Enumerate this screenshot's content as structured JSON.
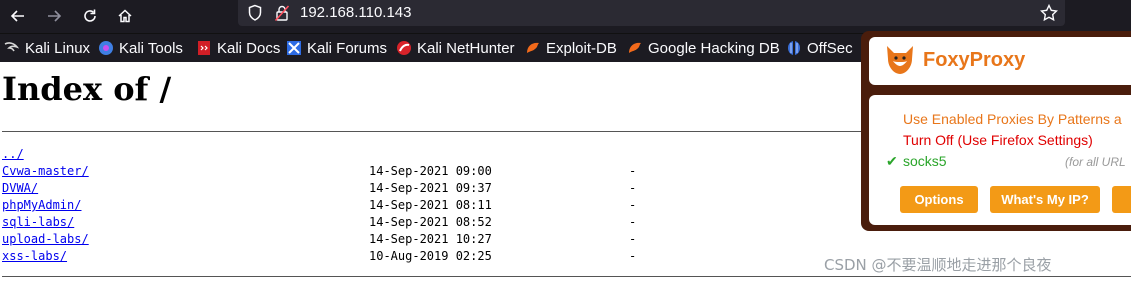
{
  "browser": {
    "url": "192.168.110.143"
  },
  "bookmarks": [
    {
      "label": "Kali Linux",
      "icon": "kali-dragon-icon"
    },
    {
      "label": "Kali Tools",
      "icon": "kali-tools-icon"
    },
    {
      "label": "Kali Docs",
      "icon": "kali-docs-icon"
    },
    {
      "label": "Kali Forums",
      "icon": "kali-forums-icon"
    },
    {
      "label": "Kali NetHunter",
      "icon": "nethunter-icon"
    },
    {
      "label": "Exploit-DB",
      "icon": "exploit-db-icon"
    },
    {
      "label": "Google Hacking DB",
      "icon": "ghdb-icon"
    },
    {
      "label": "OffSec",
      "icon": "offsec-icon"
    }
  ],
  "page": {
    "title": "Index of /",
    "parent_link": "../",
    "entries": [
      {
        "name": "Cvwa-master/",
        "date": "14-Sep-2021 09:00",
        "size": "-"
      },
      {
        "name": "DVWA/",
        "date": "14-Sep-2021 09:37",
        "size": "-"
      },
      {
        "name": "phpMyAdmin/",
        "date": "14-Sep-2021 08:11",
        "size": "-"
      },
      {
        "name": "sqli-labs/",
        "date": "14-Sep-2021 08:52",
        "size": "-"
      },
      {
        "name": "upload-labs/",
        "date": "14-Sep-2021 10:27",
        "size": "-"
      },
      {
        "name": "xss-labs/",
        "date": "10-Aug-2019 02:25",
        "size": "-"
      }
    ]
  },
  "foxyproxy": {
    "title": "FoxyProxy",
    "option_patterns": "Use Enabled Proxies By Patterns a",
    "option_off": "Turn Off (Use Firefox Settings)",
    "proxy_check": "✔",
    "proxy_name": "socks5",
    "proxy_scope": "(for all URL",
    "btn_options": "Options",
    "btn_whats_my_ip": "What's My IP?",
    "accent_color": "#e8761a"
  },
  "watermark": "CSDN @不要温顺地走进那个良夜"
}
